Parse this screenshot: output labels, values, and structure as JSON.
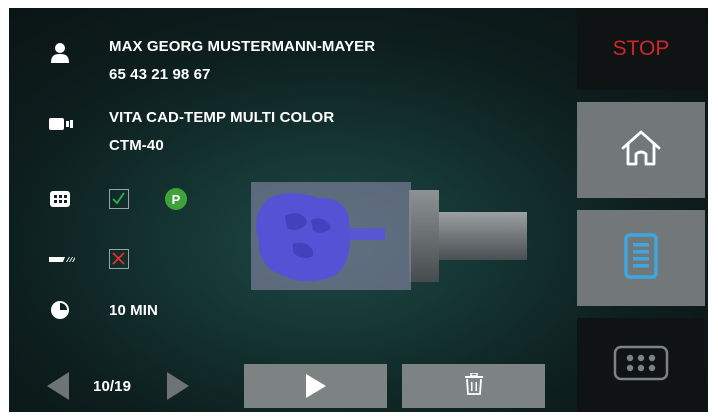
{
  "patient": {
    "name": "MAX GEORG MUSTERMANN-MAYER",
    "id": "65 43 21 98 67"
  },
  "material": {
    "name": "VITA CAD-TEMP MULTI COLOR",
    "size": "CTM-40"
  },
  "options": {
    "badge": "P"
  },
  "time": {
    "label": "10 MIN"
  },
  "pager": {
    "position": "10/19"
  },
  "side": {
    "stop_label": "STOP"
  },
  "colors": {
    "stop_red": "#d0262a",
    "check_green": "#2db34a",
    "cross_red": "#e03030",
    "badge_green": "#3fa33a",
    "active_blue": "#3ea6e0"
  },
  "icons": [
    "user-icon",
    "camera-icon",
    "keypad-icon",
    "blade-icon",
    "clock-icon",
    "prev-arrow-icon",
    "next-arrow-icon",
    "play-icon",
    "trash-icon",
    "home-icon",
    "list-icon",
    "grid-icon"
  ]
}
